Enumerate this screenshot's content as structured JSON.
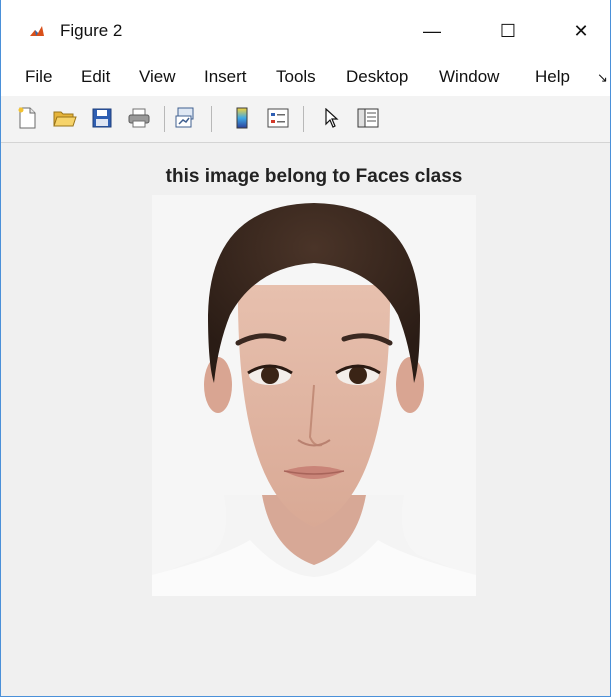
{
  "window": {
    "title": "Figure 2",
    "controls": {
      "minimize": "—",
      "maximize": "☐",
      "close": "✕"
    }
  },
  "menu": {
    "items": [
      "File",
      "Edit",
      "View",
      "Insert",
      "Tools",
      "Desktop",
      "Window",
      "Help"
    ],
    "overflow": "↘"
  },
  "toolbar": {
    "buttons": [
      "new-figure-icon",
      "open-file-icon",
      "save-icon",
      "print-icon",
      "link-plot-icon",
      "colorbar-icon",
      "legend-icon",
      "pointer-icon",
      "property-editor-icon"
    ]
  },
  "figure": {
    "axes_title": "this image belong to Faces class"
  }
}
